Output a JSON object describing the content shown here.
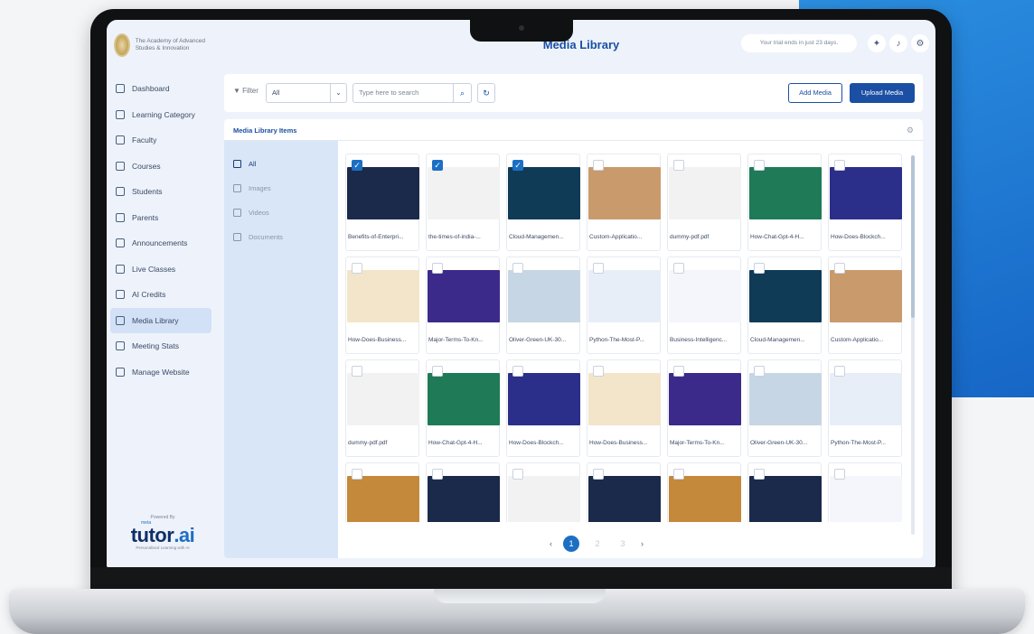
{
  "brand": {
    "name": "The Academy of Advanced Studies & Innovation"
  },
  "header": {
    "title": "Media Library",
    "trial": "Your trial ends in just 23 days."
  },
  "sidebar": {
    "items": [
      {
        "label": "Dashboard",
        "icon": "dashboard-icon"
      },
      {
        "label": "Learning Category",
        "icon": "category-icon"
      },
      {
        "label": "Faculty",
        "icon": "user-icon"
      },
      {
        "label": "Courses",
        "icon": "book-icon"
      },
      {
        "label": "Students",
        "icon": "student-icon"
      },
      {
        "label": "Parents",
        "icon": "parents-icon"
      },
      {
        "label": "Announcements",
        "icon": "megaphone-icon"
      },
      {
        "label": "Live Classes",
        "icon": "live-icon"
      },
      {
        "label": "AI Credits",
        "icon": "credits-icon"
      },
      {
        "label": "Media Library",
        "icon": "media-icon",
        "active": true
      },
      {
        "label": "Meeting Stats",
        "icon": "stats-icon"
      },
      {
        "label": "Manage Website",
        "icon": "website-icon"
      }
    ],
    "powered_by": "Powered By",
    "logo_prefix": "meta",
    "logo": "tutor",
    "logo_suffix": ".ai",
    "tagline": "Personalised Learning with AI"
  },
  "filter": {
    "label": "Filter",
    "select_value": "All",
    "search_placeholder": "Type here to search",
    "add_media": "Add Media",
    "upload_media": "Upload Media"
  },
  "library": {
    "title": "Media Library Items",
    "categories": [
      {
        "label": "All",
        "active": true
      },
      {
        "label": "Images"
      },
      {
        "label": "Videos"
      },
      {
        "label": "Documents"
      }
    ],
    "items": [
      {
        "name": "Benefits-of-Enterpri...",
        "checked": true,
        "color": "#1b2a4a"
      },
      {
        "name": "the-times-of-india-...",
        "checked": true,
        "color": "#f2f2f2"
      },
      {
        "name": "Cloud-Managemen...",
        "checked": true,
        "color": "#0f3b57"
      },
      {
        "name": "Custom-Applicatio...",
        "checked": false,
        "color": "#c99a6b"
      },
      {
        "name": "dummy-pdf.pdf",
        "checked": false,
        "color": "#f2f2f2"
      },
      {
        "name": "How-Chat-Gpt-4-H...",
        "checked": false,
        "color": "#1f7a57"
      },
      {
        "name": "How-Does-Blockch...",
        "checked": false,
        "color": "#2b2f8a"
      },
      {
        "name": "How-Does-Business...",
        "checked": false,
        "color": "#f3e5c9"
      },
      {
        "name": "Major-Terms-To-Kn...",
        "checked": false,
        "color": "#3b2a8a"
      },
      {
        "name": "Oliver-Green-UK-30...",
        "checked": false,
        "color": "#c7d6e4"
      },
      {
        "name": "Python-The-Most-P...",
        "checked": false,
        "color": "#e8eef8"
      },
      {
        "name": "Business-Intelligenc...",
        "checked": false,
        "color": "#f4f6fb"
      },
      {
        "name": "Cloud-Managemen...",
        "checked": false,
        "color": "#0f3b57"
      },
      {
        "name": "Custom-Applicatio...",
        "checked": false,
        "color": "#c99a6b"
      },
      {
        "name": "dummy-pdf.pdf",
        "checked": false,
        "color": "#f2f2f2"
      },
      {
        "name": "How-Chat-Gpt-4-H...",
        "checked": false,
        "color": "#1f7a57"
      },
      {
        "name": "How-Does-Blockch...",
        "checked": false,
        "color": "#2b2f8a"
      },
      {
        "name": "How-Does-Business...",
        "checked": false,
        "color": "#f3e5c9"
      },
      {
        "name": "Major-Terms-To-Kn...",
        "checked": false,
        "color": "#3b2a8a"
      },
      {
        "name": "Oliver-Green-UK-30...",
        "checked": false,
        "color": "#c7d6e4"
      },
      {
        "name": "Python-The-Most-P...",
        "checked": false,
        "color": "#e8eef8"
      },
      {
        "name": "",
        "checked": false,
        "color": "#c4893a"
      },
      {
        "name": "",
        "checked": false,
        "color": "#1b2a4a"
      },
      {
        "name": "",
        "checked": false,
        "color": "#f2f2f2"
      },
      {
        "name": "",
        "checked": false,
        "color": "#1b2a4a"
      },
      {
        "name": "",
        "checked": false,
        "color": "#c4893a"
      },
      {
        "name": "",
        "checked": false,
        "color": "#1b2a4a"
      },
      {
        "name": "",
        "checked": false,
        "color": "#f4f6fb"
      }
    ]
  },
  "pagination": {
    "prev": "‹",
    "pages": [
      "1",
      "2",
      "3"
    ],
    "next": "›",
    "current": "1"
  },
  "colors": {
    "accent": "#1b4fa3",
    "brand_blue": "#1d6fc4",
    "background_panel": "#2b8fe0"
  }
}
